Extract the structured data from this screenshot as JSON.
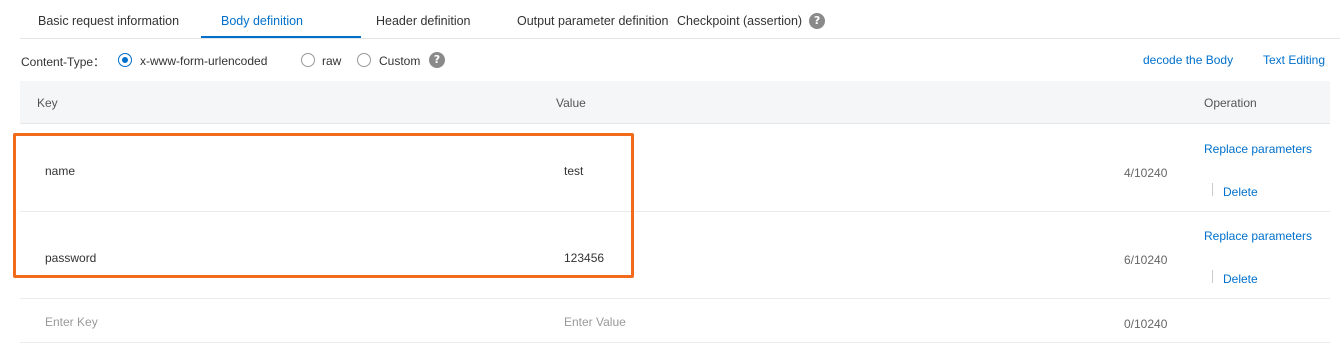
{
  "tabs": {
    "basic": "Basic request information",
    "body": "Body definition",
    "header": "Header definition",
    "output": "Output parameter definition",
    "checkpoint": "Checkpoint (assertion)",
    "active_color": "#0070cc"
  },
  "content_type": {
    "label": "Content-Type：",
    "options": [
      "x-www-form-urlencoded",
      "raw",
      "Custom"
    ],
    "selected": "x-www-form-urlencoded",
    "decode_link": "decode the Body",
    "text_editing_link": "Text Editing"
  },
  "table": {
    "headers": {
      "key": "Key",
      "value": "Value",
      "operation": "Operation"
    },
    "rows": [
      {
        "key": "name",
        "value": "test",
        "count": "4/10240",
        "replace": "Replace parameters",
        "delete": "Delete"
      },
      {
        "key": "password",
        "value": "123456",
        "count": "6/10240",
        "replace": "Replace parameters",
        "delete": "Delete"
      }
    ],
    "new_row": {
      "key_placeholder": "Enter Key",
      "value_placeholder": "Enter Value",
      "count": "0/10240"
    }
  },
  "highlight_color": "#f26b1d"
}
